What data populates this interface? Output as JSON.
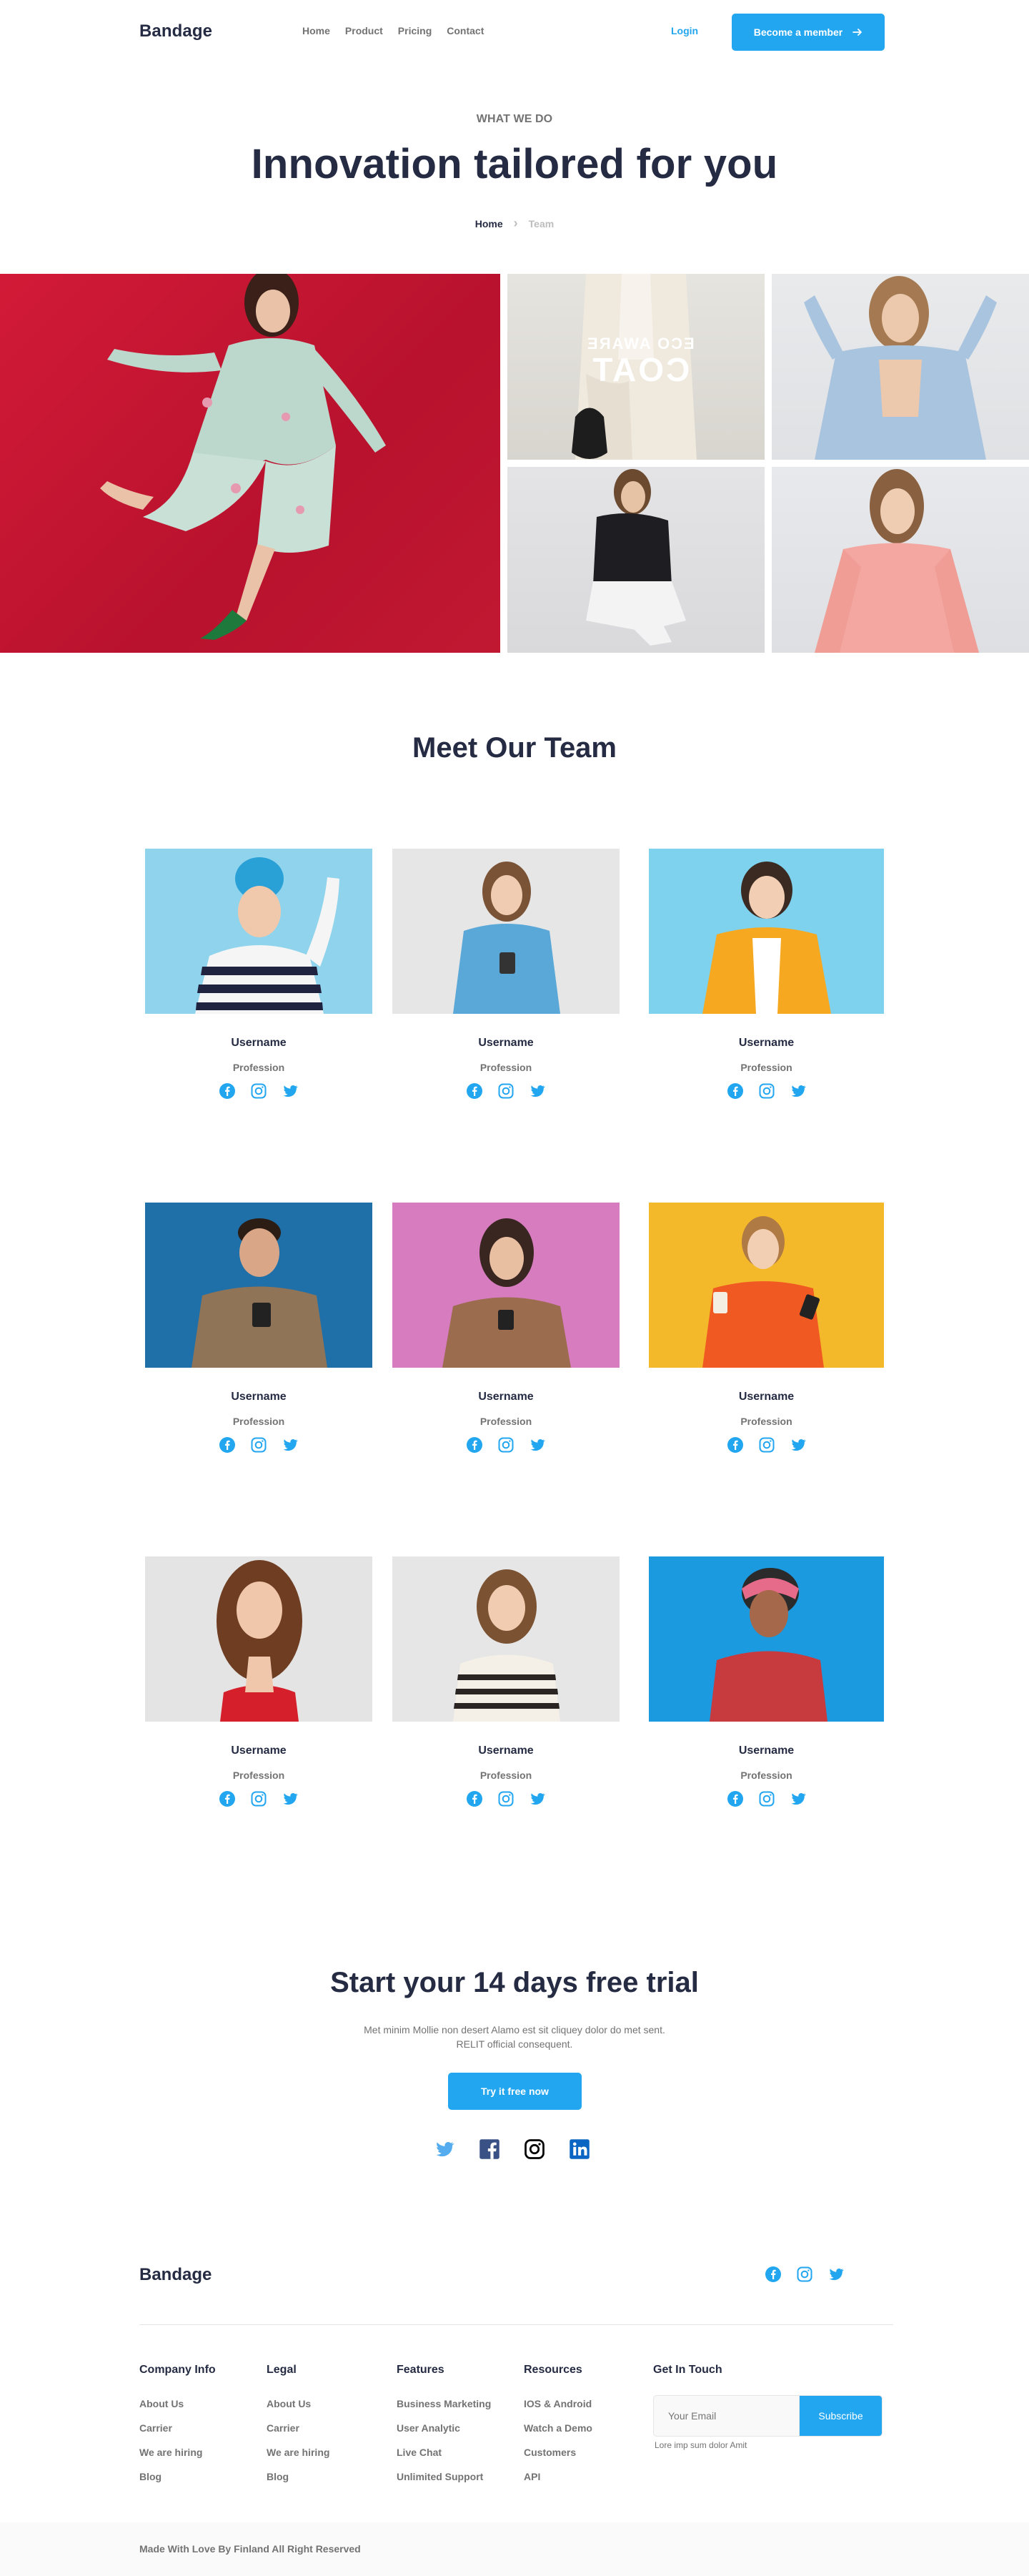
{
  "nav": {
    "brand": "Bandage",
    "links": [
      "Home",
      "Product",
      "Pricing",
      "Contact"
    ],
    "login": "Login",
    "cta": "Become a member"
  },
  "hero": {
    "eyebrow": "WHAT WE DO",
    "title": "Innovation tailored for you",
    "breadcrumb_home": "Home",
    "breadcrumb_current": "Team"
  },
  "gallery": {
    "coat_line1": "ECO AWARE",
    "coat_line2": "COAT"
  },
  "team": {
    "title": "Meet Our Team",
    "members": [
      {
        "name": "Username",
        "profession": "Profession"
      },
      {
        "name": "Username",
        "profession": "Profession"
      },
      {
        "name": "Username",
        "profession": "Profession"
      },
      {
        "name": "Username",
        "profession": "Profession"
      },
      {
        "name": "Username",
        "profession": "Profession"
      },
      {
        "name": "Username",
        "profession": "Profession"
      },
      {
        "name": "Username",
        "profession": "Profession"
      },
      {
        "name": "Username",
        "profession": "Profession"
      },
      {
        "name": "Username",
        "profession": "Profession"
      }
    ]
  },
  "trial": {
    "title": "Start your 14 days free trial",
    "text": "Met minim Mollie non desert Alamo est sit cliquey dolor do met sent. RELIT official consequent.",
    "button": "Try it free now"
  },
  "footer": {
    "brand": "Bandage",
    "columns": [
      {
        "title": "Company Info",
        "links": [
          "About Us",
          "Carrier",
          "We are hiring",
          "Blog"
        ]
      },
      {
        "title": "Legal",
        "links": [
          "About Us",
          "Carrier",
          "We are hiring",
          "Blog"
        ]
      },
      {
        "title": "Features",
        "links": [
          "Business Marketing",
          "User Analytic",
          "Live Chat",
          "Unlimited Support"
        ]
      },
      {
        "title": "Resources",
        "links": [
          "IOS & Android",
          "Watch a Demo",
          "Customers",
          "API"
        ]
      }
    ],
    "get_in_touch": "Get In Touch",
    "email_placeholder": "Your Email",
    "subscribe": "Subscribe",
    "note": "Lore imp sum dolor Amit",
    "copyright": "Made With Love By Finland All Right Reserved"
  },
  "colors": {
    "primary": "#23A6F0",
    "dark": "#252B42",
    "muted": "#737373"
  }
}
